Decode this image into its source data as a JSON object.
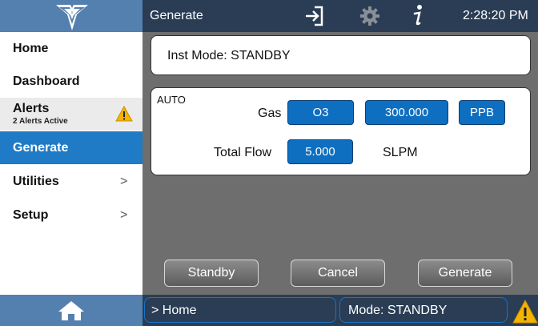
{
  "header": {
    "title": "Generate",
    "time": "2:28:20 PM",
    "icons": [
      "logo-icon",
      "exit-icon",
      "gear-icon",
      "info-icon"
    ]
  },
  "sidebar": {
    "items": [
      {
        "label": "Home"
      },
      {
        "label": "Dashboard"
      },
      {
        "label": "Alerts",
        "sublabel": "2 Alerts Active"
      },
      {
        "label": "Generate"
      },
      {
        "label": "Utilities",
        "chevron": ">"
      },
      {
        "label": "Setup",
        "chevron": ">"
      }
    ]
  },
  "main": {
    "inst_mode": "Inst Mode:  STANDBY",
    "auto_label": "AUTO",
    "gas_label": "Gas",
    "gas_value": "O3",
    "concentration": "300.000",
    "concentration_unit": "PPB",
    "total_flow_label": "Total Flow",
    "total_flow_value": "5.000",
    "total_flow_unit": "SLPM",
    "buttons": {
      "standby": "Standby",
      "cancel": "Cancel",
      "generate": "Generate"
    }
  },
  "footer": {
    "breadcrumb": "> Home",
    "mode": "Mode: STANDBY"
  },
  "colors": {
    "topbar": "#2a3d55",
    "logo_bg": "#5480b0",
    "active": "#1f7bc6",
    "panel_bg": "#6e6e6e",
    "button_blue": "#0e6ec0",
    "warning": "#f4b400"
  }
}
